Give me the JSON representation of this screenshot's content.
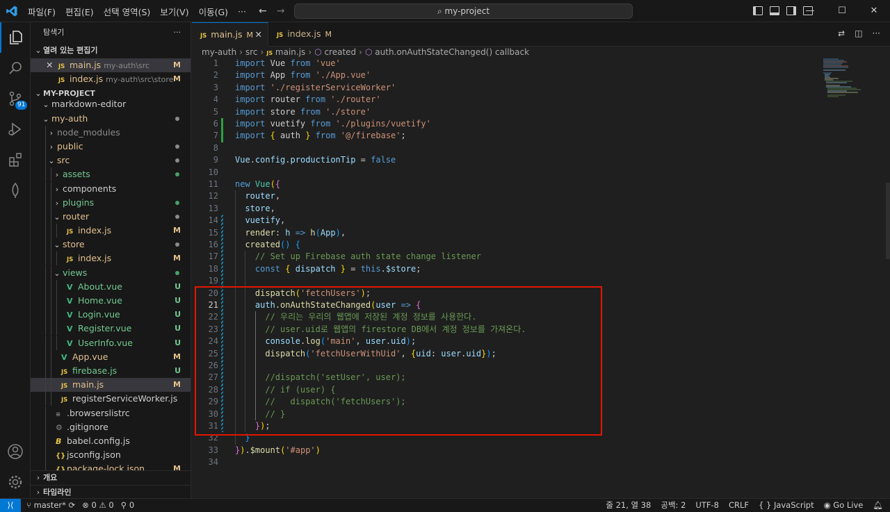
{
  "titlebar": {
    "menu": [
      "파일(F)",
      "편집(E)",
      "선택 영역(S)",
      "보기(V)",
      "이동(G)",
      "···"
    ],
    "search": "my-project",
    "controls": [
      "—",
      "☐",
      "✕"
    ]
  },
  "activity_bar": {
    "items": [
      {
        "name": "explorer-icon",
        "active": true
      },
      {
        "name": "search-icon"
      },
      {
        "name": "source-control-icon",
        "badge": "91"
      },
      {
        "name": "run-debug-icon"
      },
      {
        "name": "extensions-icon"
      },
      {
        "name": "mongodb-icon"
      }
    ],
    "bottom": [
      {
        "name": "account-icon"
      },
      {
        "name": "manage-gear-icon"
      }
    ]
  },
  "sidebar": {
    "title": "탐색기",
    "more": "···",
    "open_editors_label": "열려 있는 편집기",
    "open_editors": [
      {
        "name": "main.js",
        "path": "my-auth\\src",
        "status": "M",
        "close": "✕"
      },
      {
        "name": "index.js",
        "path": "my-auth\\src\\store",
        "status": "M"
      }
    ],
    "project_label": "MY-PROJECT",
    "tree": [
      {
        "label": "markdown-editor",
        "depth": 0,
        "kind": "folder",
        "open": true,
        "cls": "c-def"
      },
      {
        "label": "my-auth",
        "depth": 0,
        "kind": "folder",
        "open": true,
        "cls": "c-mod",
        "dot": "#8b8b8b"
      },
      {
        "label": "node_modules",
        "depth": 1,
        "kind": "folder",
        "open": false,
        "cls": "c-dim"
      },
      {
        "label": "public",
        "depth": 1,
        "kind": "folder",
        "open": false,
        "cls": "c-mod",
        "dot": "#8b8b8b"
      },
      {
        "label": "src",
        "depth": 1,
        "kind": "folder",
        "open": true,
        "cls": "c-mod",
        "dot": "#8b8b8b"
      },
      {
        "label": "assets",
        "depth": 2,
        "kind": "folder",
        "open": false,
        "cls": "c-unt",
        "dot": "#4b9e6c"
      },
      {
        "label": "components",
        "depth": 2,
        "kind": "folder",
        "open": false,
        "cls": "c-def"
      },
      {
        "label": "plugins",
        "depth": 2,
        "kind": "folder",
        "open": false,
        "cls": "c-unt",
        "dot": "#4b9e6c"
      },
      {
        "label": "router",
        "depth": 2,
        "kind": "folder",
        "open": true,
        "cls": "c-mod",
        "dot": "#8b8b8b"
      },
      {
        "label": "index.js",
        "depth": 3,
        "kind": "js",
        "cls": "c-mod",
        "status": "M"
      },
      {
        "label": "store",
        "depth": 2,
        "kind": "folder",
        "open": true,
        "cls": "c-mod",
        "dot": "#8b8b8b"
      },
      {
        "label": "index.js",
        "depth": 3,
        "kind": "js",
        "cls": "c-mod",
        "status": "M"
      },
      {
        "label": "views",
        "depth": 2,
        "kind": "folder",
        "open": true,
        "cls": "c-unt",
        "dot": "#4b9e6c"
      },
      {
        "label": "About.vue",
        "depth": 3,
        "kind": "vue",
        "cls": "c-unt",
        "status": "U"
      },
      {
        "label": "Home.vue",
        "depth": 3,
        "kind": "vue",
        "cls": "c-unt",
        "status": "U"
      },
      {
        "label": "Login.vue",
        "depth": 3,
        "kind": "vue",
        "cls": "c-unt",
        "status": "U"
      },
      {
        "label": "Register.vue",
        "depth": 3,
        "kind": "vue",
        "cls": "c-unt",
        "status": "U"
      },
      {
        "label": "UserInfo.vue",
        "depth": 3,
        "kind": "vue",
        "cls": "c-unt",
        "status": "U"
      },
      {
        "label": "App.vue",
        "depth": 2,
        "kind": "vue",
        "cls": "c-mod",
        "status": "M"
      },
      {
        "label": "firebase.js",
        "depth": 2,
        "kind": "js",
        "cls": "c-unt",
        "status": "U"
      },
      {
        "label": "main.js",
        "depth": 2,
        "kind": "js",
        "cls": "c-mod",
        "status": "M",
        "selected": true
      },
      {
        "label": "registerServiceWorker.js",
        "depth": 2,
        "kind": "js",
        "cls": "c-def"
      },
      {
        "label": ".browserslistrc",
        "depth": 1,
        "kind": "dot",
        "cls": "c-def"
      },
      {
        "label": ".gitignore",
        "depth": 1,
        "kind": "gear",
        "cls": "c-def"
      },
      {
        "label": "babel.config.js",
        "depth": 1,
        "kind": "babel",
        "cls": "c-def"
      },
      {
        "label": "jsconfig.json",
        "depth": 1,
        "kind": "json",
        "cls": "c-def"
      },
      {
        "label": "package-lock.json",
        "depth": 1,
        "kind": "json",
        "cls": "c-mod",
        "status": "M"
      }
    ],
    "outline_label": "개요",
    "timeline_label": "타임라인"
  },
  "tabs": [
    {
      "icon": "JS",
      "label": "main.js",
      "status": "M",
      "active": true,
      "close": "✕"
    },
    {
      "icon": "JS",
      "label": "index.js",
      "status": "M",
      "active": false
    }
  ],
  "breadcrumb": [
    "my-auth",
    "src",
    "main.js",
    "created",
    "auth.onAuthStateChanged() callback"
  ],
  "code": {
    "line_numbers": [
      "1",
      "2",
      "3",
      "4",
      "5",
      "6",
      "7",
      "8",
      "9",
      "10",
      "11",
      "12",
      "13",
      "14",
      "15",
      "16",
      "17",
      "18",
      "19",
      "20",
      "21",
      "22",
      "23",
      "24",
      "25",
      "26",
      "27",
      "28",
      "29",
      "30",
      "31",
      "32",
      "33",
      "34"
    ],
    "current_line": 21,
    "lines": [
      [
        [
          "k",
          "import"
        ],
        [
          "t",
          " Vue "
        ],
        [
          "k",
          "from"
        ],
        [
          "t",
          " "
        ],
        [
          "s",
          "'vue'"
        ]
      ],
      [
        [
          "k",
          "import"
        ],
        [
          "t",
          " App "
        ],
        [
          "k",
          "from"
        ],
        [
          "t",
          " "
        ],
        [
          "s",
          "'./App.vue'"
        ]
      ],
      [
        [
          "k",
          "import"
        ],
        [
          "t",
          " "
        ],
        [
          "s",
          "'./registerServiceWorker'"
        ]
      ],
      [
        [
          "k",
          "import"
        ],
        [
          "t",
          " router "
        ],
        [
          "k",
          "from"
        ],
        [
          "t",
          " "
        ],
        [
          "s",
          "'./router'"
        ]
      ],
      [
        [
          "k",
          "import"
        ],
        [
          "t",
          " store "
        ],
        [
          "k",
          "from"
        ],
        [
          "t",
          " "
        ],
        [
          "s",
          "'./store'"
        ]
      ],
      [
        [
          "k",
          "import"
        ],
        [
          "t",
          " vuetify "
        ],
        [
          "k",
          "from"
        ],
        [
          "t",
          " "
        ],
        [
          "s",
          "'./plugins/vuetify'"
        ]
      ],
      [
        [
          "k",
          "import"
        ],
        [
          "t",
          " "
        ],
        [
          "p1",
          "{"
        ],
        [
          "t",
          " auth "
        ],
        [
          "p1",
          "}"
        ],
        [
          "t",
          " "
        ],
        [
          "k",
          "from"
        ],
        [
          "t",
          " "
        ],
        [
          "s",
          "'@/firebase'"
        ],
        [
          "t",
          ";"
        ]
      ],
      [],
      [
        [
          "v",
          "Vue"
        ],
        [
          "t",
          "."
        ],
        [
          "v",
          "config"
        ],
        [
          "t",
          "."
        ],
        [
          "v",
          "productionTip"
        ],
        [
          "t",
          " = "
        ],
        [
          "k",
          "false"
        ]
      ],
      [],
      [
        [
          "k",
          "new"
        ],
        [
          "t",
          " "
        ],
        [
          "cls",
          "Vue"
        ],
        [
          "p1",
          "("
        ],
        [
          "p2",
          "{"
        ]
      ],
      [
        [
          "t",
          "  "
        ],
        [
          "v",
          "router"
        ],
        [
          "t",
          ","
        ]
      ],
      [
        [
          "t",
          "  "
        ],
        [
          "v",
          "store"
        ],
        [
          "t",
          ","
        ]
      ],
      [
        [
          "t",
          "  "
        ],
        [
          "v",
          "vuetify"
        ],
        [
          "t",
          ","
        ]
      ],
      [
        [
          "t",
          "  "
        ],
        [
          "f",
          "render"
        ],
        [
          "t",
          ": "
        ],
        [
          "v",
          "h"
        ],
        [
          "t",
          " "
        ],
        [
          "k",
          "=>"
        ],
        [
          "t",
          " "
        ],
        [
          "f",
          "h"
        ],
        [
          "p3",
          "("
        ],
        [
          "v",
          "App"
        ],
        [
          "p3",
          ")"
        ],
        [
          "t",
          ","
        ]
      ],
      [
        [
          "t",
          "  "
        ],
        [
          "f",
          "created"
        ],
        [
          "p3",
          "()"
        ],
        [
          "t",
          " "
        ],
        [
          "p3",
          "{"
        ]
      ],
      [
        [
          "t",
          "    "
        ],
        [
          "cm",
          "// Set up Firebase auth state change listener"
        ]
      ],
      [
        [
          "t",
          "    "
        ],
        [
          "k",
          "const"
        ],
        [
          "t",
          " "
        ],
        [
          "p1",
          "{"
        ],
        [
          "t",
          " "
        ],
        [
          "v",
          "dispatch"
        ],
        [
          "t",
          " "
        ],
        [
          "p1",
          "}"
        ],
        [
          "t",
          " = "
        ],
        [
          "k",
          "this"
        ],
        [
          "t",
          "."
        ],
        [
          "v",
          "$store"
        ],
        [
          "t",
          ";"
        ]
      ],
      [],
      [
        [
          "t",
          "    "
        ],
        [
          "f",
          "dispatch"
        ],
        [
          "p1",
          "("
        ],
        [
          "s",
          "'fetchUsers'"
        ],
        [
          "p1",
          ")"
        ],
        [
          "t",
          ";"
        ]
      ],
      [
        [
          "t",
          "    "
        ],
        [
          "v",
          "auth"
        ],
        [
          "t",
          "."
        ],
        [
          "f",
          "onAuthStateChanged"
        ],
        [
          "p1",
          "("
        ],
        [
          "v",
          "user"
        ],
        [
          "t",
          " "
        ],
        [
          "k",
          "=>"
        ],
        [
          "t",
          " "
        ],
        [
          "p2",
          "{"
        ]
      ],
      [
        [
          "t",
          "      "
        ],
        [
          "cm",
          "// 우리는 우리의 웹앱에 저장된 계정 정보를 사용한다."
        ]
      ],
      [
        [
          "t",
          "      "
        ],
        [
          "cm",
          "// user.uid로 웹앱의 firestore DB에서 계정 정보를 가져온다."
        ]
      ],
      [
        [
          "t",
          "      "
        ],
        [
          "v",
          "console"
        ],
        [
          "t",
          "."
        ],
        [
          "f",
          "log"
        ],
        [
          "p3",
          "("
        ],
        [
          "s",
          "'main'"
        ],
        [
          "t",
          ", "
        ],
        [
          "v",
          "user"
        ],
        [
          "t",
          "."
        ],
        [
          "v",
          "uid"
        ],
        [
          "p3",
          ")"
        ],
        [
          "t",
          ";"
        ]
      ],
      [
        [
          "t",
          "      "
        ],
        [
          "f",
          "dispatch"
        ],
        [
          "p3",
          "("
        ],
        [
          "s",
          "'fetchUserWithUid'"
        ],
        [
          "t",
          ", "
        ],
        [
          "p1",
          "{"
        ],
        [
          "v",
          "uid"
        ],
        [
          "t",
          ": "
        ],
        [
          "v",
          "user"
        ],
        [
          "t",
          "."
        ],
        [
          "v",
          "uid"
        ],
        [
          "p1",
          "}"
        ],
        [
          "p3",
          ")"
        ],
        [
          "t",
          ";"
        ]
      ],
      [],
      [
        [
          "t",
          "      "
        ],
        [
          "cm",
          "//dispatch('setUser', user);"
        ]
      ],
      [
        [
          "t",
          "      "
        ],
        [
          "cm",
          "// if (user) {"
        ]
      ],
      [
        [
          "t",
          "      "
        ],
        [
          "cm",
          "//   dispatch('fetchUsers');"
        ]
      ],
      [
        [
          "t",
          "      "
        ],
        [
          "cm",
          "// }"
        ]
      ],
      [
        [
          "t",
          "    "
        ],
        [
          "p2",
          "}"
        ],
        [
          "p1",
          ")"
        ],
        [
          "t",
          ";"
        ]
      ],
      [
        [
          "t",
          "  "
        ],
        [
          "p3",
          "}"
        ]
      ],
      [
        [
          "p2",
          "}"
        ],
        [
          "p1",
          ")"
        ],
        [
          "t",
          "."
        ],
        [
          "f",
          "$mount"
        ],
        [
          "p1",
          "("
        ],
        [
          "s",
          "'#app'"
        ],
        [
          "p1",
          ")"
        ]
      ],
      []
    ]
  },
  "statusbar": {
    "remote": "⟩⟨",
    "branch": "master*",
    "errors": "0",
    "warnings": "0",
    "ports": "0",
    "position": "줄 21, 열 38",
    "spaces": "공백: 2",
    "encoding": "UTF-8",
    "eol": "CRLF",
    "language": "JavaScript",
    "golive": "Go Live"
  },
  "colors": {
    "accent": "#0078d4",
    "highlight_box": "#e51400",
    "added": "#2ea043",
    "modified": "#1b81a8"
  }
}
